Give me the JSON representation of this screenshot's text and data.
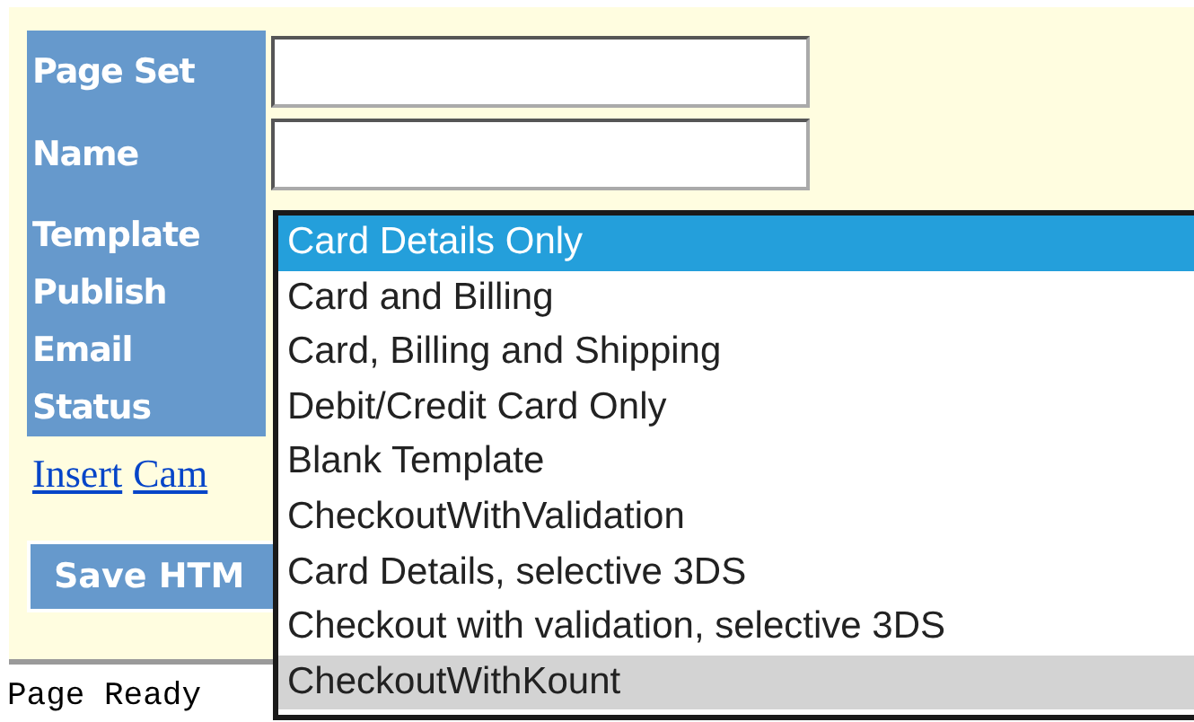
{
  "form": {
    "fields": [
      {
        "label": "Page Set",
        "kind": "text"
      },
      {
        "label": "Name",
        "kind": "text"
      },
      {
        "label": "Template",
        "kind": "label"
      },
      {
        "label": "Publish",
        "kind": "label"
      },
      {
        "label": "Email",
        "kind": "label"
      },
      {
        "label": "Status",
        "kind": "label"
      }
    ],
    "links": [
      "Insert",
      "Cam"
    ],
    "save_button": "Save HTM"
  },
  "template_dropdown": {
    "options": [
      {
        "label": "Card Details Only",
        "selected": true,
        "hovered": false
      },
      {
        "label": "Card and Billing",
        "selected": false,
        "hovered": false
      },
      {
        "label": "Card, Billing and Shipping",
        "selected": false,
        "hovered": false
      },
      {
        "label": "Debit/Credit Card Only",
        "selected": false,
        "hovered": false
      },
      {
        "label": "Blank Template",
        "selected": false,
        "hovered": false
      },
      {
        "label": "CheckoutWithValidation",
        "selected": false,
        "hovered": false
      },
      {
        "label": "Card Details, selective 3DS",
        "selected": false,
        "hovered": false
      },
      {
        "label": "Checkout with validation, selective 3DS",
        "selected": false,
        "hovered": false
      },
      {
        "label": "CheckoutWithKount",
        "selected": false,
        "hovered": true
      }
    ]
  },
  "status_bar": "Page Ready"
}
